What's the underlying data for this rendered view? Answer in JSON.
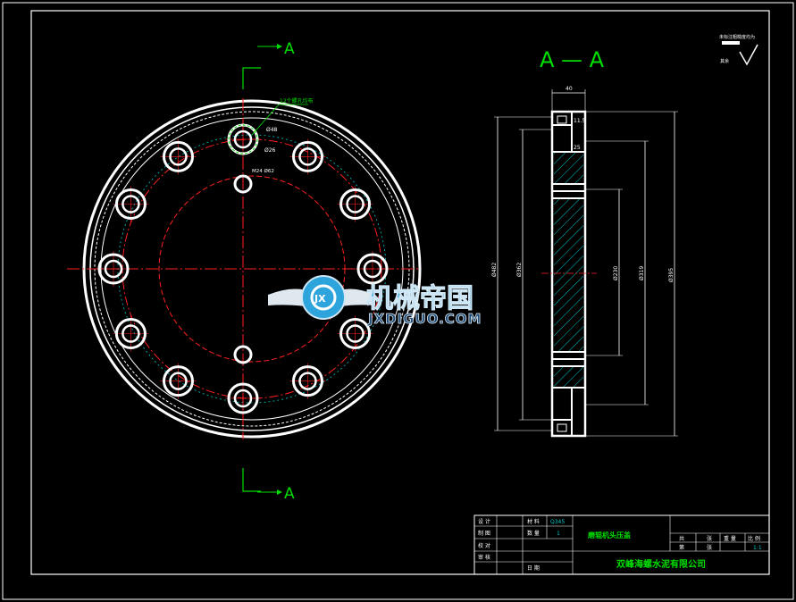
{
  "section_marks": {
    "top": "A",
    "bottom": "A",
    "view_title": "A — A"
  },
  "plan_view": {
    "hole_note": "12个螺孔均布",
    "dim_hole_outer": "Ø48",
    "dim_hole_inner": "Ø26",
    "dim_pitch": "M24 Ø62",
    "hole_count": 12
  },
  "section_view": {
    "dim_width": "40",
    "dim_step1": "11.5",
    "dim_step2": "25",
    "dim_d_a": "Ø230",
    "dim_d_b": "Ø319",
    "dim_d_c": "Ø395",
    "dim_h_a": "Ø482",
    "dim_h_b": "Ø362"
  },
  "roughness_note": {
    "text": "未标注粗糙度均为",
    "sub": "其余"
  },
  "title_block": {
    "left_labels": [
      "设 计",
      "制 图",
      "校 对",
      "审 核"
    ],
    "material_label": "材 料",
    "material_value": "Q345",
    "qty_label": "数 量",
    "qty_value": "1",
    "date_label": "日 期",
    "part_name": "磨辊机头压盖",
    "sheet_total": "共",
    "sheet_word": "张",
    "weight_label": "重 量",
    "scale_label": "比 例",
    "sheet_no": "第",
    "sheet_word2": "张",
    "scale_value": "1:1",
    "company": "双峰海螺水泥有限公司"
  },
  "watermark": {
    "cn": "机械帝国",
    "en": "JXDIGUO.COM",
    "badge": "JX"
  },
  "colors": {
    "white": "#ffffff",
    "red": "#ff2020",
    "green": "#00dd00",
    "cyan": "#00c8c8",
    "brand": "#2ea4dc"
  }
}
